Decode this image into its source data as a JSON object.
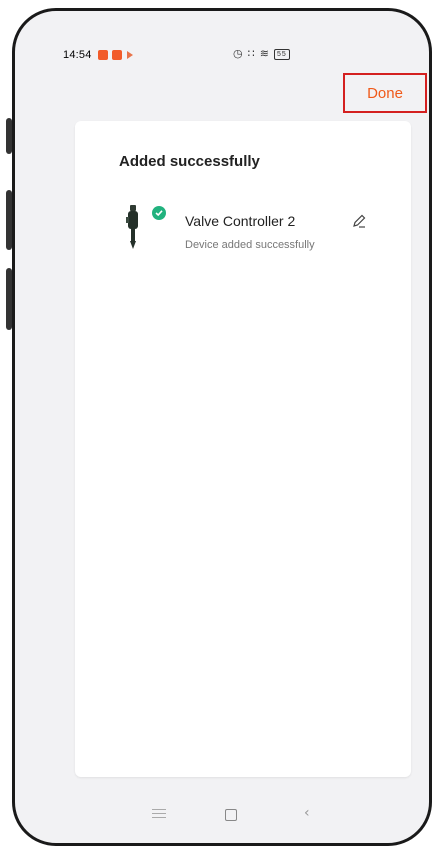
{
  "status_bar": {
    "time": "14:54",
    "icons_right": "⏰ ⁙∥ ≡",
    "battery": "55"
  },
  "header": {
    "done_label": "Done"
  },
  "card": {
    "title": "Added successfully",
    "device": {
      "name": "Valve Controller 2",
      "subtitle": "Device added successfully",
      "status": "success"
    }
  },
  "colors": {
    "accent": "#f05a1a",
    "success": "#21b27e",
    "highlight_box": "#d42020"
  },
  "icons": [
    "notification-icon",
    "play-icon",
    "alarm-icon",
    "signal-icon",
    "wifi-icon",
    "battery-icon",
    "check-icon",
    "pencil-icon",
    "menu-icon",
    "home-icon",
    "back-icon",
    "valve-device-icon"
  ]
}
